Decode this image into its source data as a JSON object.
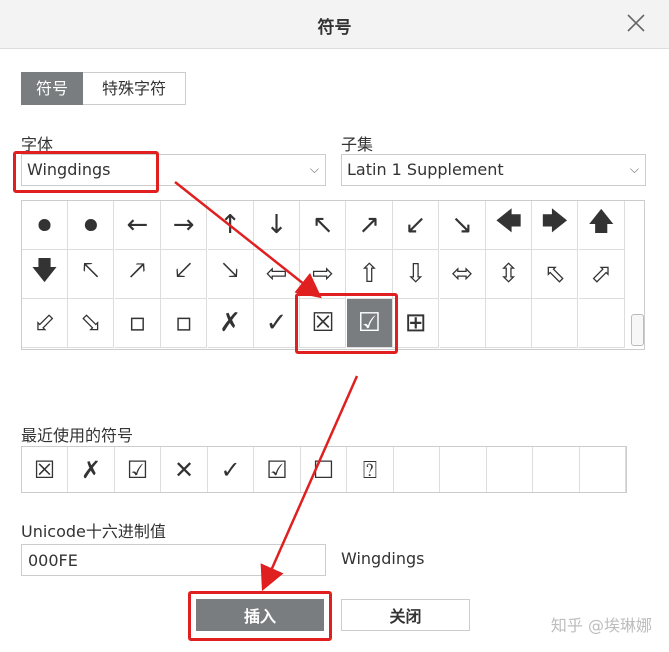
{
  "dialog": {
    "title": "符号"
  },
  "tabs": [
    {
      "label": "符号"
    },
    {
      "label": "特殊字符"
    }
  ],
  "font": {
    "label": "字体",
    "value": "Wingdings"
  },
  "subset": {
    "label": "子集",
    "value": "Latin 1 Supplement"
  },
  "symbols": {
    "rows": [
      [
        "⏺",
        "⏺",
        "←",
        "→",
        "↑",
        "↓",
        "↖",
        "↗",
        "↙",
        "↘",
        "🡄",
        "🡆",
        "🡅"
      ],
      [
        "🡇",
        "🡔",
        "🡕",
        "🡗",
        "🡖",
        "⇦",
        "⇨",
        "⇧",
        "⇩",
        "⬄",
        "⇳",
        "⬁",
        "⬀"
      ],
      [
        "⬃",
        "⬂",
        "▫",
        "▫",
        "✗",
        "✓",
        "☒",
        "☑",
        "⊞",
        "",
        "",
        "",
        ""
      ]
    ],
    "selected_row": 2,
    "selected_col": 7
  },
  "recent": {
    "label": "最近使用的符号",
    "items": [
      "☒",
      "✗",
      "☑",
      "✕",
      "✓",
      "☑",
      "☐",
      "⍰",
      "",
      "",
      "",
      "",
      ""
    ]
  },
  "unicode": {
    "label": "Unicode十六进制值",
    "value": "000FE",
    "font_name": "Wingdings"
  },
  "buttons": {
    "insert": "插入",
    "close": "关闭"
  },
  "watermark": "知乎 @埃琳娜",
  "colors": {
    "accent": "#7a7d80",
    "highlight": "#e02020"
  }
}
